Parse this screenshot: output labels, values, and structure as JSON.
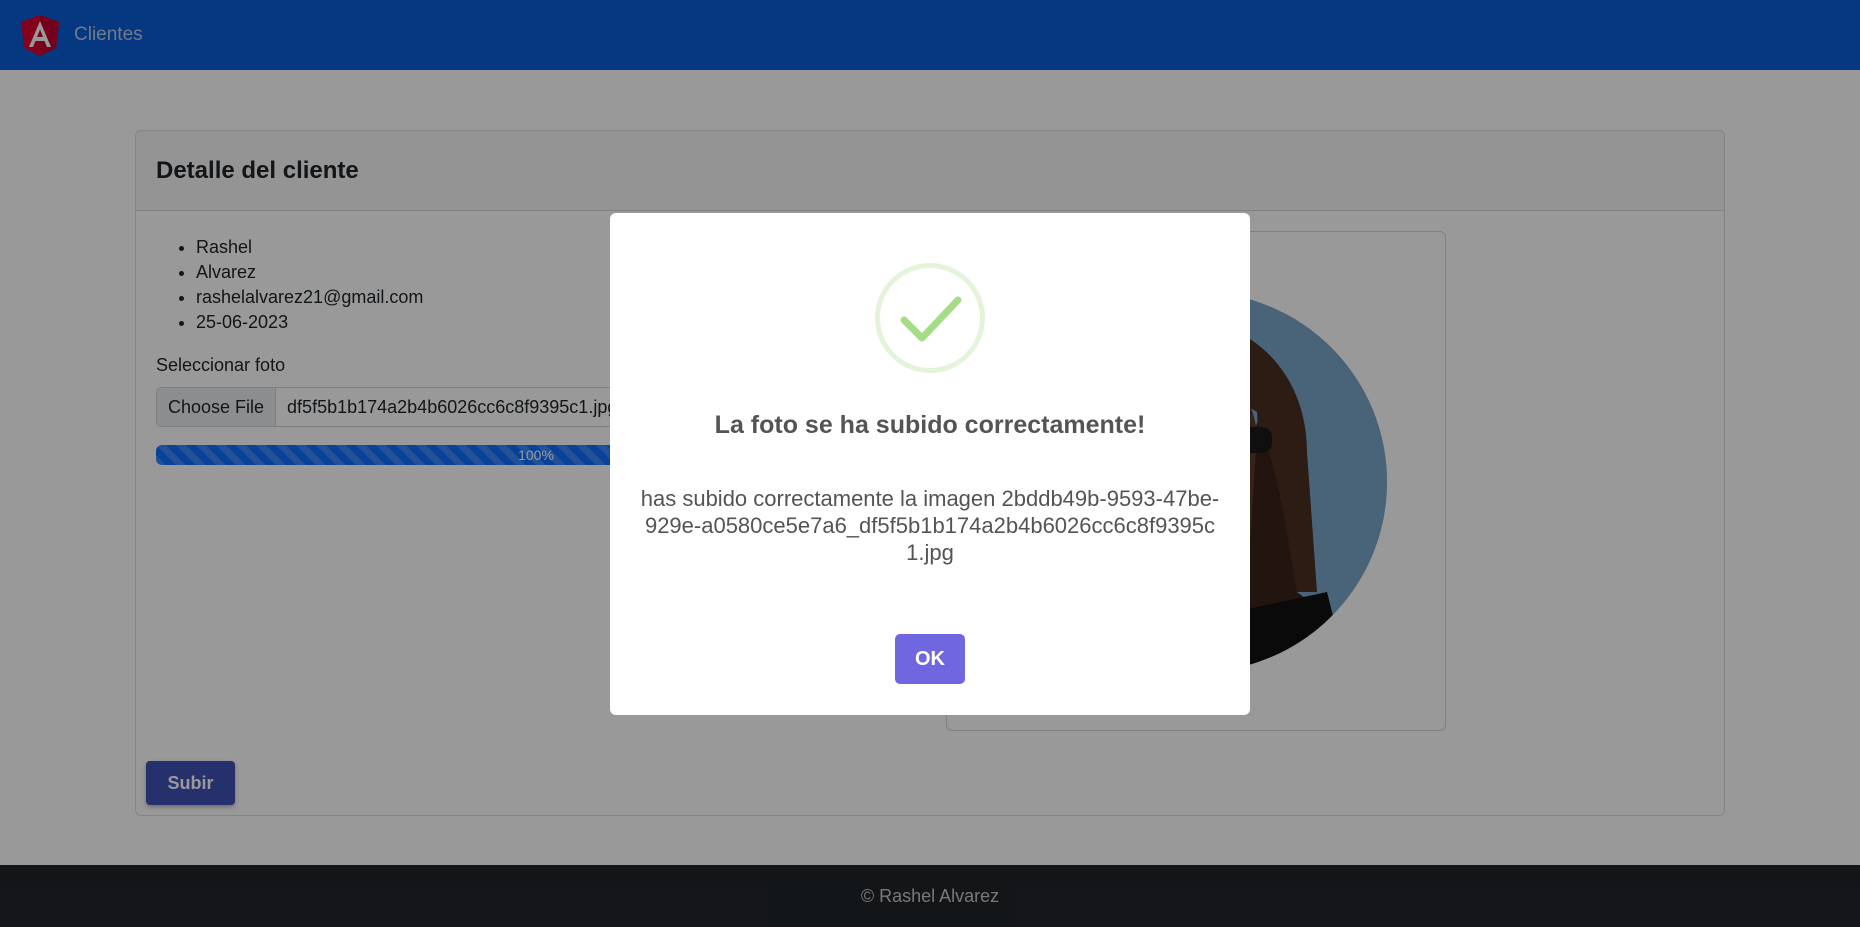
{
  "navbar": {
    "link": "Clientes"
  },
  "card": {
    "title": "Detalle del cliente",
    "details": [
      "Rashel",
      "Alvarez",
      "rashelalvarez21@gmail.com",
      "25-06-2023"
    ],
    "select_label": "Seleccionar foto",
    "file_button": "Choose File",
    "file_name": "df5f5b1b174a2b4b6026cc6c8f9395c1.jpg",
    "progress": {
      "value": 100,
      "label": "100%"
    },
    "upload_button": "Subir"
  },
  "footer": {
    "text": "© Rashel Alvarez"
  },
  "modal": {
    "title": "La foto se ha subido correctamente!",
    "text": "has subido correctamente la imagen 2bddb49b-9593-47be-929e-a0580ce5e7a6_df5f5b1b174a2b4b6026cc6c8f9395c1.jpg",
    "ok_button": "OK"
  },
  "colors": {
    "navbar": "#0b5ed7",
    "progress": "#0d6efd",
    "upload_button": "#3f51b5",
    "ok_button": "#7066e0",
    "success": "#a5dc86"
  }
}
